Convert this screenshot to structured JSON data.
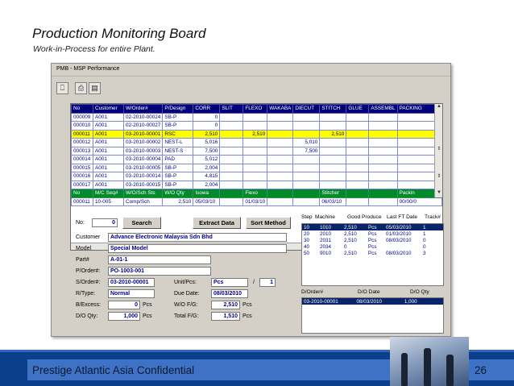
{
  "slide": {
    "title": "Production Monitoring Board",
    "subtitle": "Work-in-Process for entire Plant.",
    "footer": "Prestige Atlantic Asia Confidential",
    "page_number": "26"
  },
  "window": {
    "title": "PMB - MSP Performance",
    "toolbar": [
      "exit-icon",
      "print-icon",
      "preview-icon"
    ]
  },
  "grid": {
    "headers": [
      "No",
      "Customer",
      "W/Order#",
      "P/Design",
      "CORR",
      "SLIT",
      "FLEXO",
      "WAKABA",
      "DIECUT",
      "STITCH",
      "GLUE",
      "ASSEMBL",
      "PACKING"
    ],
    "rows": [
      [
        "000009",
        "A001",
        "02-2010-00024",
        "SB-P",
        "0",
        "",
        "",
        "",
        "",
        "",
        "",
        "",
        ""
      ],
      [
        "000010",
        "A001",
        "02-2010-00027",
        "SB-P",
        "0",
        "",
        "",
        "",
        "",
        "",
        "",
        "",
        ""
      ],
      [
        "000011",
        "A001",
        "03-2010-00001",
        "RSC",
        "2,510",
        "",
        "2,510",
        "",
        "",
        "2,510",
        "",
        "",
        ""
      ],
      [
        "000012",
        "A001",
        "03-2010-00002",
        "NEST-L",
        "5,016",
        "",
        "",
        "",
        "5,010",
        "",
        "",
        "",
        ""
      ],
      [
        "000013",
        "A001",
        "03-2010-00003",
        "NEST-S",
        "7,500",
        "",
        "",
        "",
        "7,500",
        "",
        "",
        "",
        ""
      ],
      [
        "000014",
        "A001",
        "03-2010-00004",
        "PAD",
        "5,012",
        "",
        "",
        "",
        "",
        "",
        "",
        "",
        ""
      ],
      [
        "000015",
        "A001",
        "03-2010-00005",
        "SB-P",
        "2,004",
        "",
        "",
        "",
        "",
        "",
        "",
        "",
        ""
      ],
      [
        "000016",
        "A001",
        "03-2010-00014",
        "SB-P",
        "4,815",
        "",
        "",
        "",
        "",
        "",
        "",
        "",
        ""
      ],
      [
        "000017",
        "A001",
        "03-2010-00015",
        "SB-P",
        "2,004",
        "",
        "",
        "",
        "",
        "",
        "",
        "",
        ""
      ]
    ],
    "selected_row": 2,
    "headers2": [
      "No",
      "M/C Seq#",
      "W/O/Sch Sts",
      "W/O Qty",
      "Isowa",
      "",
      "Flexo",
      "",
      "",
      "Stitcher",
      "",
      "",
      "Packin"
    ],
    "detail_row": [
      "000011",
      "10-005",
      "Comp/Sch",
      "2,510",
      "05/03/10",
      "",
      "01/03/10",
      "",
      "",
      "06/03/10",
      "",
      "",
      "00/00/0"
    ]
  },
  "form": {
    "no_label": "No:",
    "no_value": "0",
    "search_button": "Search",
    "extract_button": "Extract Data",
    "sort_button": "Sort Method",
    "customer_label": "Customer",
    "customer_value": "Advance Electronic Malaysia Sdn Bhd",
    "model_label": "Model",
    "model_value": "Special Model",
    "part_label": "Part#",
    "part_value": "A-01-1",
    "porder_label": "P/Order#:",
    "porder_value": "PO-1003-001",
    "sorder_label": "S/Order#:",
    "sorder_value": "03-2010-00001",
    "unit_label": "Unit/Pcs:",
    "unit_value": "Pcs",
    "unit_qty": "1",
    "rtype_label": "R/Type:",
    "rtype_value": "Normal",
    "due_label": "Due Date:",
    "due_value": "08/03/2010",
    "bexcess_label": "B/Excess:",
    "bexcess_value": "0",
    "bexcess_unit": "Pcs",
    "wofg_label": "W/O F/G:",
    "wofg_value": "2,510",
    "wofg_unit": "Pcs",
    "doqty_label": "D/O Qty:",
    "doqty_value": "1,000",
    "doqty_unit": "Pcs",
    "totalfg_label": "Total F/G:",
    "totalfg_value": "1,510",
    "totalfg_unit": "Pcs"
  },
  "steps": {
    "headers": [
      "Step",
      "Machine",
      "Good Produce",
      "Last FT Date",
      "Track#"
    ],
    "rows": [
      [
        "10",
        "1010",
        "2,510",
        "Pcs",
        "05/03/2010",
        "1"
      ],
      [
        "20",
        "2010",
        "2,510",
        "Pcs",
        "01/03/2010",
        "1"
      ],
      [
        "30",
        "2031",
        "2,510",
        "Pcs",
        "08/03/2010",
        "0"
      ],
      [
        "40",
        "2034",
        "0",
        "Pcs",
        "",
        "0"
      ],
      [
        "50",
        "9010",
        "2,510",
        "Pcs",
        "08/03/2010",
        "3"
      ]
    ],
    "selected_row": 0
  },
  "delivery": {
    "headers": [
      "D/Order#",
      "D/O Date",
      "D/O Qty"
    ],
    "rows": [
      [
        "03-2010-00001",
        "08/03/2010",
        "1,000"
      ]
    ]
  }
}
